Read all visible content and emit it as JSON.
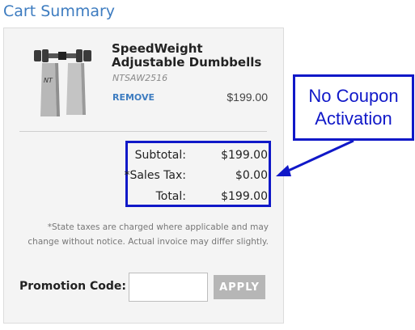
{
  "header": {
    "title": "Cart Summary"
  },
  "cart_item": {
    "name": "SpeedWeight Adjustable Dumbbells",
    "sku": "NTSAW2516",
    "remove_label": "REMOVE",
    "price": "$199.00",
    "image_icon": "dumbbell-product-image"
  },
  "totals": {
    "subtotal_label": "Subtotal:",
    "subtotal_value": "$199.00",
    "tax_label": "*Sales Tax:",
    "tax_value": "$0.00",
    "total_label": "Total:",
    "total_value": "$199.00"
  },
  "disclaimer": {
    "line1": "*State taxes are charged where applicable and may",
    "line2": "change without notice. Actual invoice may differ slightly."
  },
  "promo": {
    "label": "Promotion Code:",
    "input_value": "",
    "apply_label": "APPLY"
  },
  "annotation": {
    "line1": "No Coupon",
    "line2": "Activation",
    "color": "#1018c8"
  },
  "colors": {
    "accent": "#3d7cc0",
    "panel_bg": "#f4f4f4",
    "apply_disabled": "#b6b6b6"
  }
}
